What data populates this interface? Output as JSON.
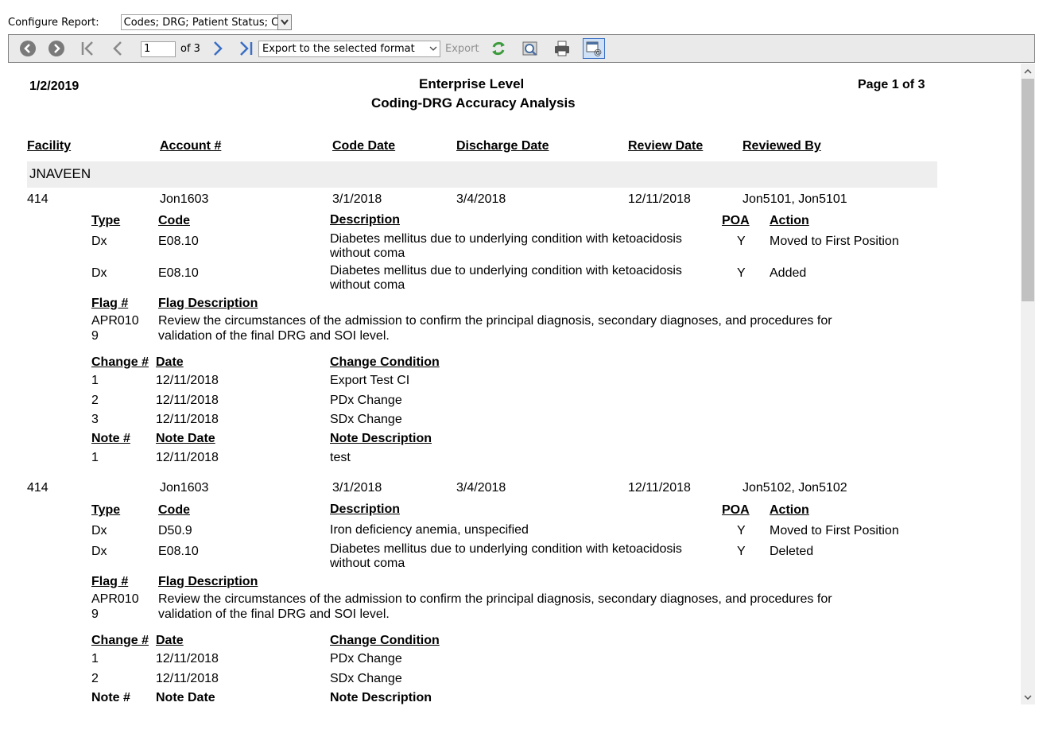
{
  "config": {
    "label": "Configure Report:",
    "value": "Codes; DRG; Patient Status; Ch"
  },
  "toolbar": {
    "page_value": "1",
    "of_label": "of 3",
    "export_format": "Export to the selected format",
    "export_label": "Export"
  },
  "report": {
    "date": "1/2/2019",
    "title1": "Enterprise Level",
    "title2": "Coding-DRG Accuracy Analysis",
    "page": "Page 1 of 3",
    "headers": {
      "facility": "Facility",
      "account": "Account #",
      "code_date": "Code Date",
      "discharge_date": "Discharge Date",
      "review_date": "Review Date",
      "reviewed_by": "Reviewed By"
    },
    "group": "JNAVEEN",
    "sub_headers": {
      "type": "Type",
      "code": "Code",
      "description": "Description",
      "poa": "POA",
      "action": "Action",
      "flag_no": "Flag #",
      "flag_desc": "Flag Description",
      "change_no": "Change #",
      "date": "Date",
      "change_cond": "Change Condition",
      "note_no": "Note #",
      "note_date": "Note Date",
      "note_desc": "Note Description"
    },
    "records": [
      {
        "facility": "414",
        "account": "Jon1603",
        "code_date": "3/1/2018",
        "discharge_date": "3/4/2018",
        "review_date": "12/11/2018",
        "reviewed_by": "Jon5101, Jon5101",
        "codes": [
          {
            "type": "Dx",
            "code": "E08.10",
            "desc": "Diabetes mellitus due to underlying condition with ketoacidosis without coma",
            "poa": "Y",
            "action": "Moved to First Position"
          },
          {
            "type": "Dx",
            "code": "E08.10",
            "desc": "Diabetes mellitus due to underlying condition with ketoacidosis without coma",
            "poa": "Y",
            "action": "Added"
          }
        ],
        "flag": {
          "no": "APR010 9",
          "desc": "Review the circumstances of the admission to confirm the principal diagnosis, secondary diagnoses, and procedures for validation of the final DRG and SOI level."
        },
        "changes": [
          {
            "no": "1",
            "date": "12/11/2018",
            "cond": "Export Test CI"
          },
          {
            "no": "2",
            "date": "12/11/2018",
            "cond": "PDx Change"
          },
          {
            "no": "3",
            "date": "12/11/2018",
            "cond": "SDx Change"
          }
        ],
        "notes": [
          {
            "no": "1",
            "date": "12/11/2018",
            "desc": "test"
          }
        ]
      },
      {
        "facility": "414",
        "account": "Jon1603",
        "code_date": "3/1/2018",
        "discharge_date": "3/4/2018",
        "review_date": "12/11/2018",
        "reviewed_by": "Jon5102, Jon5102",
        "codes": [
          {
            "type": "Dx",
            "code": "D50.9",
            "desc": "Iron deficiency anemia, unspecified",
            "poa": "Y",
            "action": "Moved to First Position"
          },
          {
            "type": "Dx",
            "code": "E08.10",
            "desc": "Diabetes mellitus due to underlying condition with ketoacidosis without coma",
            "poa": "Y",
            "action": "Deleted"
          }
        ],
        "flag": {
          "no": "APR010 9",
          "desc": "Review the circumstances of the admission to confirm the principal diagnosis, secondary diagnoses, and procedures for validation of the final DRG and SOI level."
        },
        "changes": [
          {
            "no": "1",
            "date": "12/11/2018",
            "cond": "PDx Change"
          },
          {
            "no": "2",
            "date": "12/11/2018",
            "cond": "SDx Change"
          }
        ]
      }
    ]
  },
  "icons": {
    "back": "back-circle-icon",
    "forward": "forward-circle-icon",
    "first": "first-page-icon",
    "prev": "prev-page-icon",
    "next": "next-page-icon",
    "last": "last-page-icon",
    "refresh": "refresh-icon",
    "find": "find-icon",
    "print": "print-icon",
    "email": "email-icon"
  },
  "colors": {
    "toolbar_bg": "#eaeaea",
    "nav_blue": "#3a6fc4",
    "group_bg": "#eeeeee",
    "refresh_green": "#3c9b3c"
  }
}
